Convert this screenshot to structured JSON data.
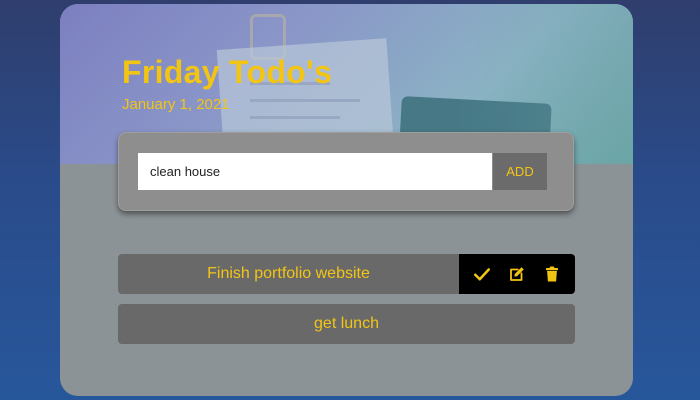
{
  "header": {
    "title": "Friday Todo's",
    "date": "January 1, 2021"
  },
  "input": {
    "value": "clean house",
    "placeholder": ""
  },
  "add_button": {
    "label": "ADD"
  },
  "todos": [
    {
      "text": "Finish portfolio website",
      "actions": [
        "check-icon",
        "edit-icon",
        "trash-icon"
      ]
    },
    {
      "text": "get lunch"
    }
  ],
  "colors": {
    "accent": "#f2c515",
    "card": "#8c9396",
    "item": "#696969",
    "actions_bg": "#000000"
  }
}
